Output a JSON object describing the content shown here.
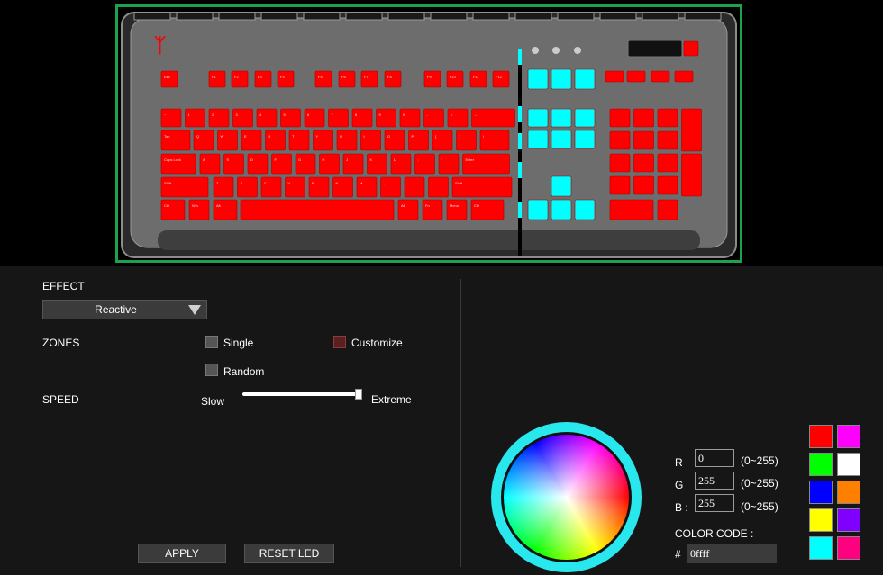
{
  "keyboard": {
    "brand_logo": "tt-logo",
    "frame_color": "#1aa34a",
    "key_color": "#ff0000",
    "numpad_highlight_color": "#00ffff",
    "rows": [
      [
        "Esc",
        "F1",
        "F2",
        "F3",
        "F4",
        "F5",
        "F6",
        "F7",
        "F8",
        "F9",
        "F10",
        "F11",
        "F12"
      ],
      [
        "~",
        "1",
        "2",
        "3",
        "4",
        "5",
        "6",
        "7",
        "8",
        "9",
        "0",
        "-",
        "=",
        "←"
      ],
      [
        "Tab",
        "Q",
        "W",
        "E",
        "R",
        "T",
        "Y",
        "U",
        "I",
        "O",
        "P",
        "[",
        "]",
        "\\"
      ],
      [
        "Caps Lock",
        "A",
        "S",
        "D",
        "F",
        "G",
        "H",
        "J",
        "K",
        "L",
        ";",
        "'",
        "Enter"
      ],
      [
        "Shift",
        "Z",
        "X",
        "C",
        "V",
        "B",
        "N",
        "M",
        ",",
        ".",
        "/",
        "Shift"
      ],
      [
        "Ctrl",
        "Win",
        "Alt",
        "",
        "Alt",
        "Fn",
        "Menu",
        "Ctrl"
      ]
    ]
  },
  "effect": {
    "label": "EFFECT",
    "selected": "Reactive"
  },
  "zones": {
    "label": "ZONES",
    "options": [
      {
        "label": "Single",
        "checked": false
      },
      {
        "label": "Customize",
        "checked": true
      },
      {
        "label": "Random",
        "checked": false
      }
    ]
  },
  "speed": {
    "label": "SPEED",
    "min_label": "Slow",
    "max_label": "Extreme",
    "value_fraction": 1.0
  },
  "buttons": {
    "apply": "APPLY",
    "reset": "RESET LED"
  },
  "color": {
    "r_label": "R",
    "g_label": "G",
    "b_label": "B :",
    "r": "0",
    "g": "255",
    "b": "255",
    "range": "(0~255)",
    "code_label": "COLOR CODE :",
    "hash": "#",
    "code": "0ffff"
  },
  "swatches": [
    "#ff0000",
    "#ff00ff",
    "#00ff00",
    "#ffffff",
    "#0000ff",
    "#ff8000",
    "#ffff00",
    "#8000ff",
    "#00ffff",
    "#ff0080"
  ]
}
